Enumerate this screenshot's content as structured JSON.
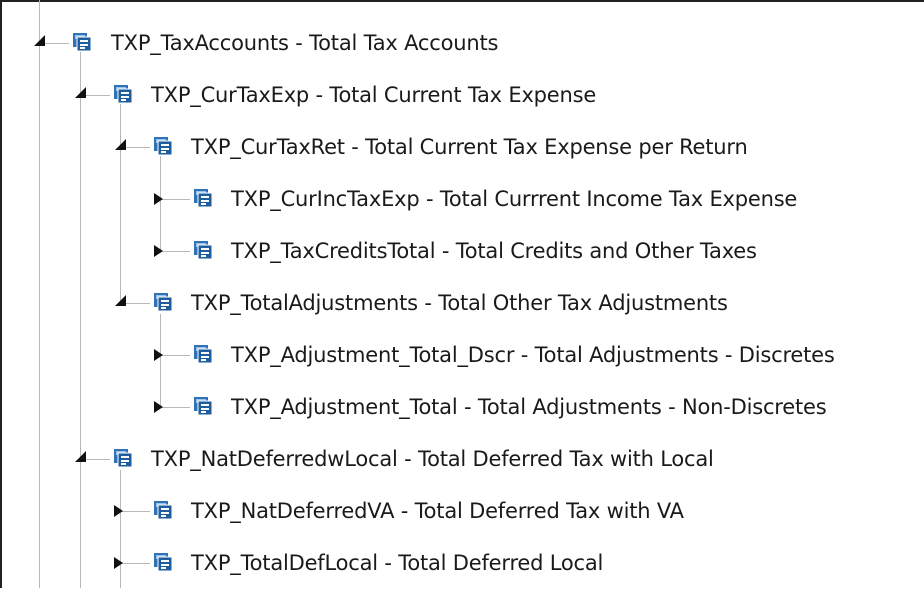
{
  "tree": {
    "nodes": [
      {
        "label": "TXP_TaxAccounts - Total Tax Accounts",
        "state": "expanded",
        "icon": "hierarchy-member-icon"
      },
      {
        "label": "TXP_CurTaxExp - Total Current Tax Expense",
        "state": "expanded",
        "icon": "hierarchy-member-icon"
      },
      {
        "label": "TXP_CurTaxRet - Total Current Tax Expense per Return",
        "state": "expanded",
        "icon": "hierarchy-member-icon"
      },
      {
        "label": "TXP_CurIncTaxExp - Total Currrent Income Tax Expense",
        "state": "collapsed",
        "icon": "hierarchy-member-icon"
      },
      {
        "label": "TXP_TaxCreditsTotal - Total Credits and Other Taxes",
        "state": "collapsed",
        "icon": "hierarchy-member-icon"
      },
      {
        "label": "TXP_TotalAdjustments - Total Other Tax Adjustments",
        "state": "expanded",
        "icon": "hierarchy-member-icon"
      },
      {
        "label": "TXP_Adjustment_Total_Dscr - Total Adjustments - Discretes",
        "state": "collapsed",
        "icon": "hierarchy-member-icon"
      },
      {
        "label": "TXP_Adjustment_Total - Total Adjustments - Non-Discretes",
        "state": "collapsed",
        "icon": "hierarchy-member-icon"
      },
      {
        "label": "TXP_NatDeferredwLocal - Total Deferred Tax with Local",
        "state": "expanded",
        "icon": "hierarchy-member-icon"
      },
      {
        "label": "TXP_NatDeferredVA - Total Deferred Tax with VA",
        "state": "collapsed",
        "icon": "hierarchy-member-icon"
      },
      {
        "label": "TXP_TotalDefLocal - Total Deferred Local",
        "state": "collapsed",
        "icon": "hierarchy-member-icon"
      }
    ]
  },
  "colors": {
    "icon_blue": "#2f72b8",
    "icon_light": "#9cc3ea",
    "connector": "#b8b8b8"
  }
}
